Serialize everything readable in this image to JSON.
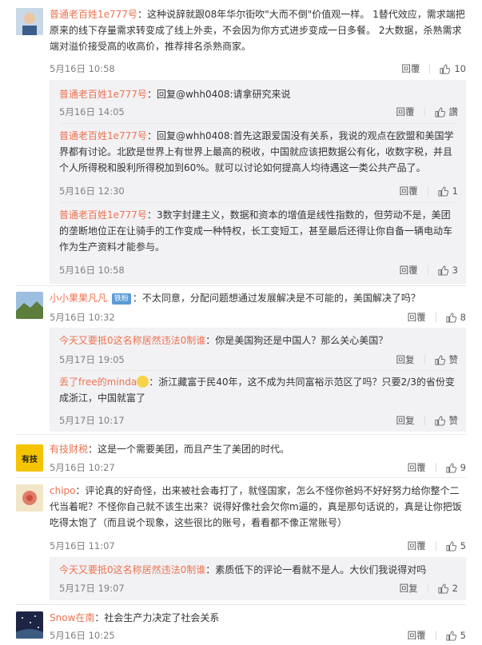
{
  "comments": [
    {
      "user": "普通老百姓1e777号",
      "text": "：这种说辞就跟08年华尔街吹\"大而不倒\"价值观一样。 1替代效应，需求端把原来的线下存量需求转变成了线上外卖，不会因为你方式进步变成一日多餐。 2大数据，杀熟需求端对溢价接受高的收高价，推荐排名杀熟商家。",
      "time": "5月16日 10:58",
      "reply": "回覆",
      "likes": "10",
      "replies": [
        {
          "user": "普通老百姓1e777号",
          "text": "：回复@whh0408:请拿研究来说",
          "time": "5月16日 14:05",
          "reply": "回覆",
          "likes": "讚"
        },
        {
          "user": "普通老百姓1e777号",
          "text": "：回复@whh0408:首先这跟爱国没有关系，我说的观点在欧盟和美国学界都有讨论。北欧是世界上有世界上最高的税收，中国就应该把数据公有化，收数字税，并且个人所得税和股利所得税加到60%。就可以讨论如何提高人均待遇这一类公共产品了。",
          "time": "5月16日 12:30",
          "reply": "回覆",
          "likes": "1"
        },
        {
          "user": "普通老百姓1e777号",
          "text": "：3数字封建主义，数据和资本的增值是线性指数的，但劳动不是，美团的垄断地位正在让骑手的工作变成一种特权，长工变短工，甚至最后还得让你自备一辆电动车作为生产资料才能参与。",
          "time": "5月16日 10:58",
          "reply": "回覆",
          "likes": "3"
        }
      ]
    },
    {
      "user": "小小果果凡凡",
      "badge": "铁粉",
      "text": "：不太同意，分配问题想通过发展解决是不可能的，美国解决了吗？",
      "time": "5月16日 10:32",
      "reply": "回覆",
      "likes": "8",
      "replies": [
        {
          "user": "今天又要抵0这名称居然违法0制谁",
          "text": "：你是美国狗还是中国人？那么关心美国？",
          "time": "5月17日 19:05",
          "reply": "回复",
          "likes": "赞"
        },
        {
          "user": "丢了free的minda",
          "text": "：浙江藏富于民40年，这不成为共同富裕示范区了吗？只要2/3的省份变成浙江，中国就富了",
          "time": "5月17日 10:17",
          "reply": "回复",
          "likes": "赞"
        }
      ]
    },
    {
      "user": "有技财税",
      "text": "：这是一个需要美团，而且产生了美团的时代。",
      "time": "5月16日 10:27",
      "reply": "回覆",
      "likes": "9",
      "avatar_text": "有技"
    },
    {
      "user": "chipo",
      "text": "：评论真的好奇怪，出来被社会毒打了，就怪国家，怎么不怪你爸妈不好好努力给你整个二代当着呢？不怪你自己就不该生出来？说得好像社会欠你m逼的，真是那句话说的，真是让你把饭吃得太饱了（而且说个现象，这些很比的账号，看看都不像正常账号）",
      "time": "5月16日 11:07",
      "reply": "回覆",
      "likes": "5",
      "replies": [
        {
          "user": "今天又要抵0这名称居然违法0制谁",
          "text": "：素质低下的评论一看就不是人。大伙们我说得对吗",
          "time": "5月17日 19:07",
          "reply": "回复",
          "likes": "2"
        }
      ]
    },
    {
      "user": "Snow在南",
      "text": "：社会生产力决定了社会关系",
      "time": "5月16日 10:25",
      "reply": "回覆",
      "likes": "5"
    }
  ],
  "colors": {
    "name": "#eb7350",
    "reply_bg": "#f2f2f5",
    "time": "#808080"
  }
}
